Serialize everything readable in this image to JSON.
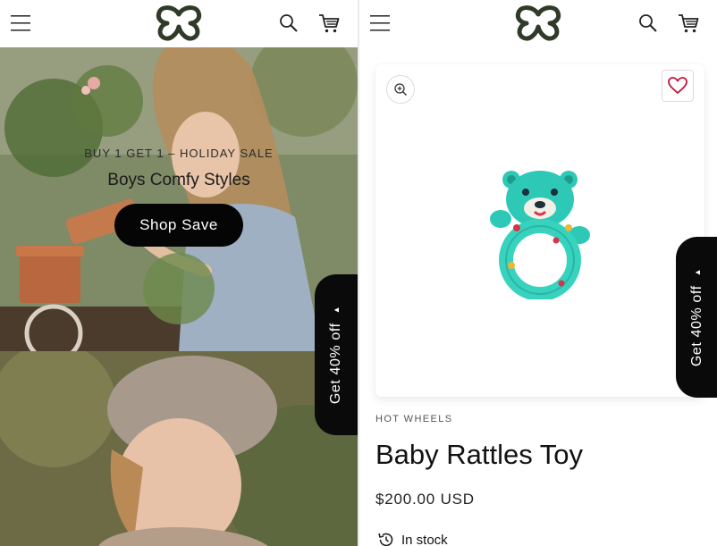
{
  "header": {
    "menu_icon": "hamburger-menu-icon",
    "logo_icon": "butterfly-logo-icon",
    "search_icon": "search-icon",
    "cart_icon": "cart-icon",
    "logo_color": "#2f3b28"
  },
  "hero": {
    "eyebrow": "BUY 1 GET 1 – HOLIDAY SALE",
    "title": "Boys Comfy Styles",
    "button_label": "Shop Save"
  },
  "promo": {
    "label": "Get 40% off",
    "caret": "▲",
    "background": "#0a0a0a"
  },
  "product": {
    "brand": "HOT WHEELS",
    "title": "Baby Rattles Toy",
    "price": "$200.00 USD",
    "stock": "In stock",
    "zoom_icon": "zoom-in-icon",
    "wishlist_icon": "heart-icon",
    "stock_icon": "history-clock-icon",
    "accent_color": "#c0143c",
    "toy_color": "#2ec9b6"
  }
}
